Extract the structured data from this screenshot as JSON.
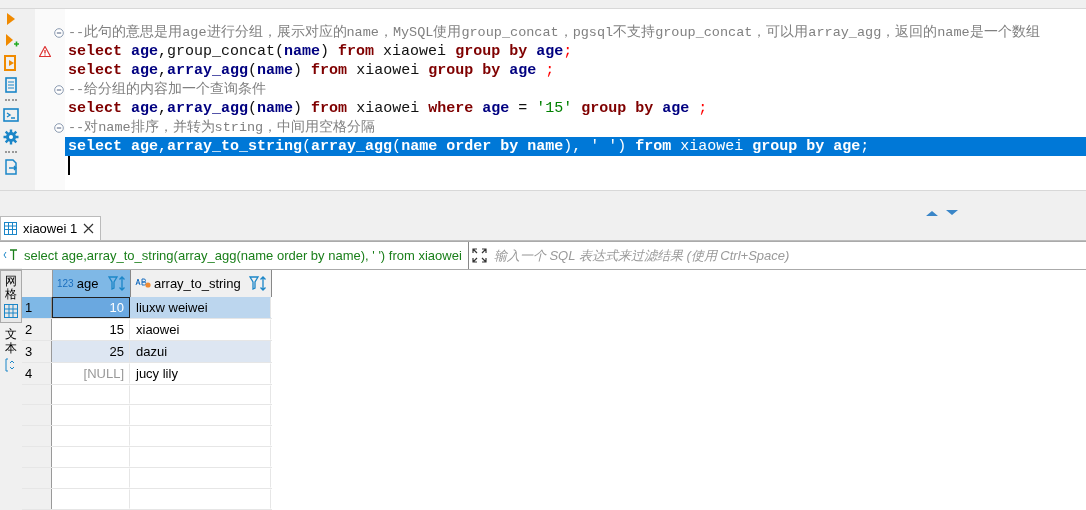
{
  "editor": {
    "lines": [
      {
        "foldable": true,
        "warning": false,
        "selected": false,
        "tokens": [
          {
            "kind": "comment",
            "t": "--此句的意思是用age进行分组，展示对应的name，MySQL使用group_concat，pgsql不支持group_concat，可以用array_agg，返回的name是一个数组"
          }
        ]
      },
      {
        "foldable": false,
        "warning": true,
        "selected": false,
        "tokens": [
          {
            "kind": "kw",
            "t": "select "
          },
          {
            "kind": "id",
            "t": "age"
          },
          {
            "kind": "plain",
            "t": ",group_concat("
          },
          {
            "kind": "id",
            "t": "name"
          },
          {
            "kind": "plain",
            "t": ") "
          },
          {
            "kind": "kw",
            "t": "from"
          },
          {
            "kind": "plain",
            "t": " xiaowei "
          },
          {
            "kind": "kw",
            "t": "group by "
          },
          {
            "kind": "id",
            "t": "age"
          },
          {
            "kind": "semi",
            "t": ";"
          }
        ]
      },
      {
        "foldable": false,
        "warning": false,
        "selected": false,
        "tokens": [
          {
            "kind": "kw",
            "t": "select "
          },
          {
            "kind": "id",
            "t": "age"
          },
          {
            "kind": "plain",
            "t": ","
          },
          {
            "kind": "id",
            "t": "array_agg"
          },
          {
            "kind": "plain",
            "t": "("
          },
          {
            "kind": "id",
            "t": "name"
          },
          {
            "kind": "plain",
            "t": ") "
          },
          {
            "kind": "kw",
            "t": "from"
          },
          {
            "kind": "plain",
            "t": " xiaowei "
          },
          {
            "kind": "kw",
            "t": "group by "
          },
          {
            "kind": "id",
            "t": "age "
          },
          {
            "kind": "semi",
            "t": ";"
          }
        ]
      },
      {
        "foldable": true,
        "warning": false,
        "selected": false,
        "tokens": [
          {
            "kind": "comment",
            "t": "--给分组的内容加一个查询条件"
          }
        ]
      },
      {
        "foldable": false,
        "warning": false,
        "selected": false,
        "tokens": [
          {
            "kind": "kw",
            "t": "select "
          },
          {
            "kind": "id",
            "t": "age"
          },
          {
            "kind": "plain",
            "t": ","
          },
          {
            "kind": "id",
            "t": "array_agg"
          },
          {
            "kind": "plain",
            "t": "("
          },
          {
            "kind": "id",
            "t": "name"
          },
          {
            "kind": "plain",
            "t": ") "
          },
          {
            "kind": "kw",
            "t": "from"
          },
          {
            "kind": "plain",
            "t": " xiaowei "
          },
          {
            "kind": "kw",
            "t": "where "
          },
          {
            "kind": "id",
            "t": "age"
          },
          {
            "kind": "plain",
            "t": " = "
          },
          {
            "kind": "str",
            "t": "'15' "
          },
          {
            "kind": "kw",
            "t": "group by "
          },
          {
            "kind": "id",
            "t": "age "
          },
          {
            "kind": "semi",
            "t": ";"
          }
        ]
      },
      {
        "foldable": true,
        "warning": false,
        "selected": false,
        "tokens": [
          {
            "kind": "comment",
            "t": "--对name排序，并转为string，中间用空格分隔"
          }
        ]
      },
      {
        "foldable": false,
        "warning": false,
        "selected": true,
        "tokens": [
          {
            "kind": "kw",
            "t": "select "
          },
          {
            "kind": "id",
            "t": "age"
          },
          {
            "kind": "plain",
            "t": ","
          },
          {
            "kind": "id",
            "t": "array_to_string"
          },
          {
            "kind": "plain",
            "t": "("
          },
          {
            "kind": "id",
            "t": "array_agg"
          },
          {
            "kind": "plain",
            "t": "("
          },
          {
            "kind": "id",
            "t": "name "
          },
          {
            "kind": "kw",
            "t": "order by "
          },
          {
            "kind": "id",
            "t": "name"
          },
          {
            "kind": "plain",
            "t": "), "
          },
          {
            "kind": "str",
            "t": "' '"
          },
          {
            "kind": "plain",
            "t": ") "
          },
          {
            "kind": "kw",
            "t": "from"
          },
          {
            "kind": "plain",
            "t": " xiaowei "
          },
          {
            "kind": "kw",
            "t": "group by "
          },
          {
            "kind": "id",
            "t": "age"
          },
          {
            "kind": "semi",
            "t": ";"
          }
        ]
      }
    ]
  },
  "result_tabs": [
    {
      "label": "xiaowei 1",
      "selected": true
    }
  ],
  "filter": {
    "query": "select age,array_to_string(array_agg(name order by name), ' ') from xiaowei",
    "placeholder": "输入一个 SQL 表达式来过滤结果 (使用 Ctrl+Space)"
  },
  "view_tabs": [
    {
      "label": "网格",
      "selected": true
    },
    {
      "label": "文本",
      "selected": false
    }
  ],
  "table": {
    "columns": [
      {
        "kind": "number",
        "type_label": "123",
        "name": "age",
        "selected": true
      },
      {
        "kind": "text",
        "name": "array_to_string",
        "selected": false
      }
    ],
    "rows": [
      {
        "number": "1",
        "age": "10",
        "value": "liuxw weiwei",
        "selected": true,
        "highlighted": false,
        "age_null": false
      },
      {
        "number": "2",
        "age": "15",
        "value": "xiaowei",
        "selected": false,
        "highlighted": false,
        "age_null": false
      },
      {
        "number": "3",
        "age": "25",
        "value": "dazui",
        "selected": false,
        "highlighted": true,
        "age_null": false
      },
      {
        "number": "4",
        "age": "[NULL]",
        "value": "jucy lily",
        "selected": false,
        "highlighted": false,
        "age_null": true
      }
    ]
  }
}
